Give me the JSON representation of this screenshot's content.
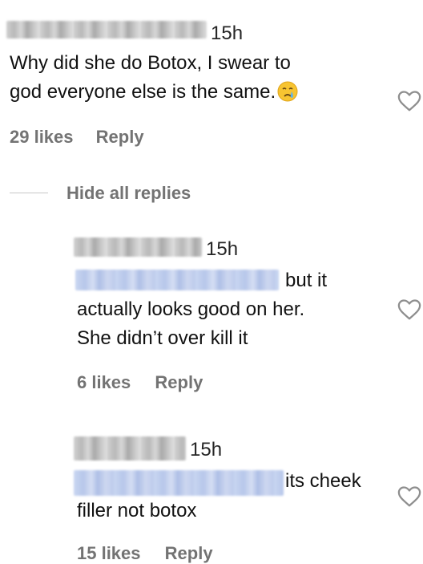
{
  "comments": [
    {
      "time": "15h",
      "text_line1": "Why did she do Botox, I swear to",
      "text_line2": "god everyone else is the same.",
      "emoji": "crying-face",
      "likes": "29 likes",
      "reply": "Reply"
    }
  ],
  "replies_toggle": "Hide all replies",
  "replies": [
    {
      "time": "15h",
      "text_line1": "but it",
      "text_line2": "actually looks good on her.",
      "text_line3": "She didn’t over kill it",
      "likes": "6 likes",
      "reply": "Reply"
    },
    {
      "time": "15h",
      "text_line1": "its cheek",
      "text_line2": "filler not botox",
      "likes": "15 likes",
      "reply": "Reply"
    }
  ],
  "colors": {
    "text": "#111111",
    "secondary": "#737373",
    "heart_stroke": "#8e8e8e",
    "mention_blur": "#bfcdee"
  },
  "icons": [
    "heart-icon",
    "crying-face-emoji"
  ]
}
